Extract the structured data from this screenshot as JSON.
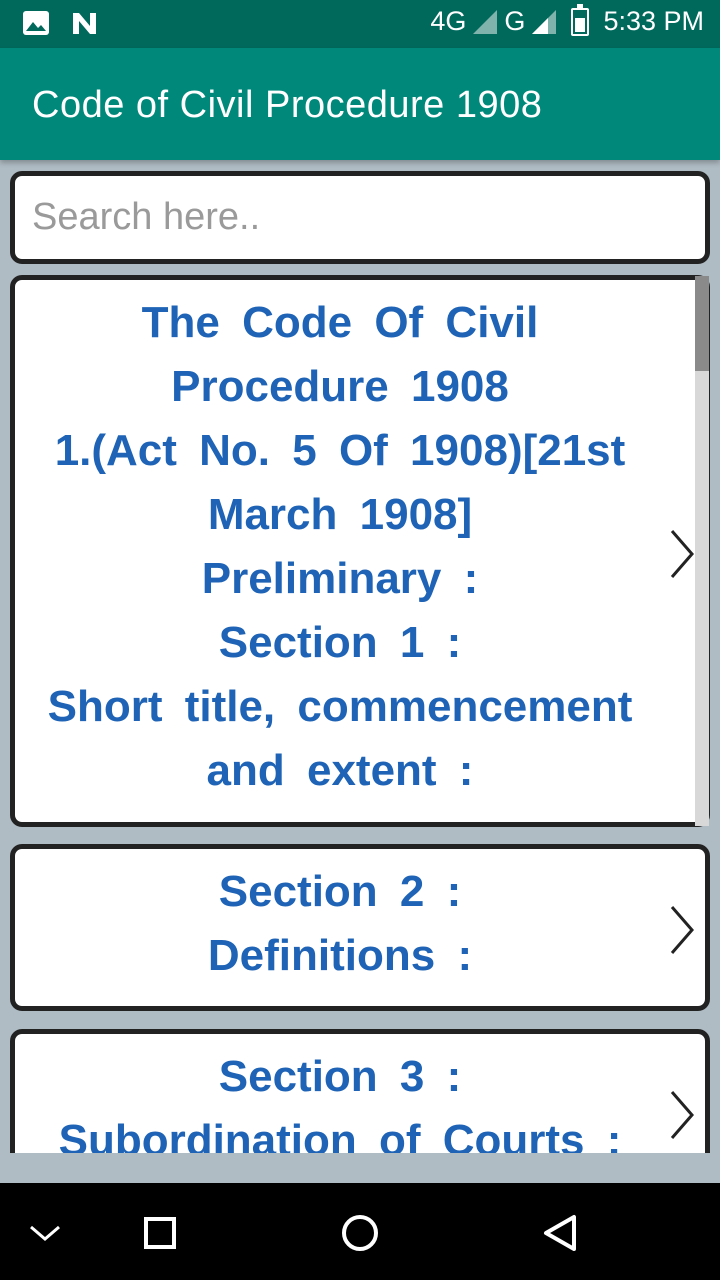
{
  "status_bar": {
    "network_4g": "4G",
    "network_g": "G",
    "time": "5:33 PM",
    "icons": [
      "image-icon",
      "n-notification-icon",
      "signal-icon",
      "battery-icon"
    ]
  },
  "app_bar": {
    "title": "Code of Civil Procedure 1908"
  },
  "search": {
    "placeholder": "Search here.."
  },
  "cards": [
    {
      "lines": [
        "The Code Of Civil",
        "Procedure 1908",
        "1.(Act No. 5 Of 1908)[21st",
        "March 1908]",
        "Preliminary :",
        "Section 1 :",
        "Short title, commencement",
        "and extent :"
      ]
    },
    {
      "lines": [
        "Section 2 :",
        "Definitions :"
      ]
    },
    {
      "lines": [
        "Section 3 :",
        "Subordination of Courts :"
      ]
    }
  ],
  "colors": {
    "status_bar": "#00695c",
    "app_bar": "#00897b",
    "card_text": "#1e63b5",
    "background": "#b0bcc4"
  },
  "nav_bar": {
    "icons": [
      "chevron-down-icon",
      "recents-square-icon",
      "home-circle-icon",
      "back-triangle-icon"
    ]
  }
}
